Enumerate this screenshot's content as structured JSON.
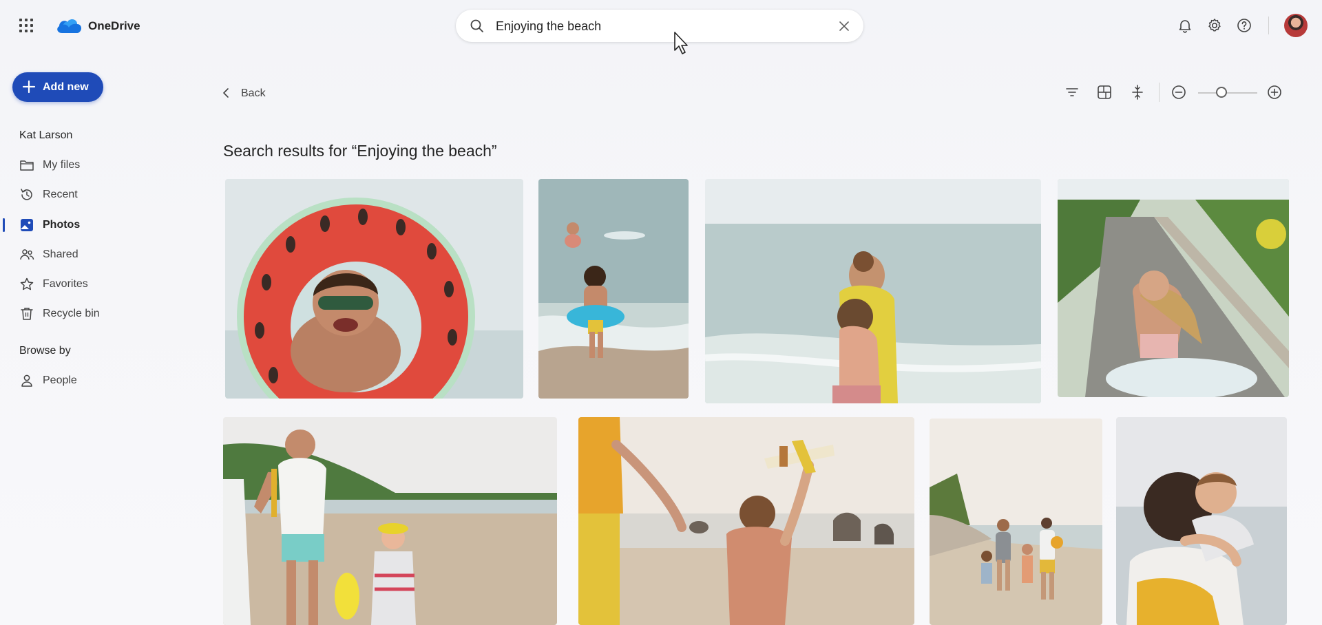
{
  "app": {
    "name": "OneDrive"
  },
  "search": {
    "value": "Enjoying the beach",
    "placeholder": "Search"
  },
  "sidebar": {
    "add_new_label": "Add new",
    "user_name": "Kat Larson",
    "items": [
      {
        "label": "My files",
        "icon": "folder-icon"
      },
      {
        "label": "Recent",
        "icon": "history-icon"
      },
      {
        "label": "Photos",
        "icon": "image-icon",
        "active": true
      },
      {
        "label": "Shared",
        "icon": "people-icon"
      },
      {
        "label": "Favorites",
        "icon": "star-icon"
      },
      {
        "label": "Recycle bin",
        "icon": "trash-icon"
      }
    ],
    "browse_by_label": "Browse by",
    "browse_items": [
      {
        "label": "People",
        "icon": "person-icon"
      }
    ]
  },
  "toolbar": {
    "back_label": "Back",
    "zoom_level": 0.4
  },
  "main": {
    "heading": "Search results for “Enjoying the beach”",
    "photos": [
      {
        "subject": "boy with watermelon float"
      },
      {
        "subject": "child wading in sea with float"
      },
      {
        "subject": "mother hugging child on beach"
      },
      {
        "subject": "girl running on path"
      },
      {
        "subject": "father and child walking on beach"
      },
      {
        "subject": "boy with toy airplane"
      },
      {
        "subject": "family on rocky beach"
      },
      {
        "subject": "father carrying son"
      }
    ]
  },
  "colors": {
    "accent": "#1f4bb8",
    "background": "#f5f5f8"
  }
}
